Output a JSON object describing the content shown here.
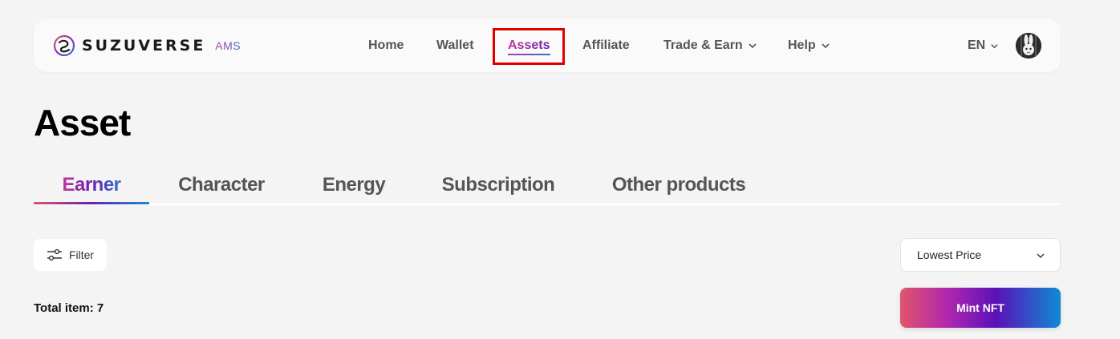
{
  "header": {
    "brand": "SUZUVERSE",
    "brand_sub": "AMS",
    "nav": [
      {
        "label": "Home"
      },
      {
        "label": "Wallet"
      },
      {
        "label": "Assets",
        "active": true
      },
      {
        "label": "Affiliate"
      },
      {
        "label": "Trade & Earn",
        "has_dropdown": true
      },
      {
        "label": "Help",
        "has_dropdown": true
      }
    ],
    "language": "EN"
  },
  "page": {
    "title": "Asset",
    "tabs": [
      {
        "label": "Earner",
        "active": true
      },
      {
        "label": "Character"
      },
      {
        "label": "Energy"
      },
      {
        "label": "Subscription"
      },
      {
        "label": "Other products"
      }
    ],
    "filter_label": "Filter",
    "sort_value": "Lowest Price",
    "total_label": "Total item: 7",
    "mint_label": "Mint NFT"
  },
  "colors": {
    "accent_pink": "#c2389a",
    "accent_purple": "#6a1fb3",
    "accent_blue": "#2f6fd0",
    "highlight_box": "#e00000"
  }
}
